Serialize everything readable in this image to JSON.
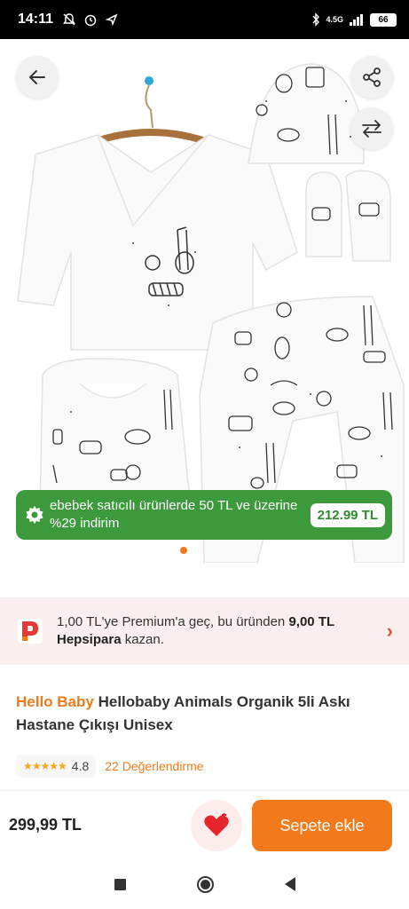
{
  "status_bar": {
    "time": "14:11",
    "network": "4.5G",
    "battery": "66"
  },
  "gallery": {
    "dots": 1,
    "active_dot": 1
  },
  "promo": {
    "text": "ebebek satıcılı ürünlerde 50 TL ve üzerine %29 indirim",
    "price": "212.99 TL"
  },
  "premium": {
    "text_prefix": "1,00 TL'ye Premium'a geç, bu üründen ",
    "amount": "9,00 TL",
    "brand": "Hepsipara",
    "text_suffix": " kazan."
  },
  "product": {
    "brand": "Hello Baby",
    "name": "Hellobaby Animals Organik 5li Askı Hastane Çıkışı Unisex",
    "rating": "4.8",
    "reviews": "22 Değerlendirme"
  },
  "actions": {
    "price": "299,99 TL",
    "add_to_cart": "Sepete ekle"
  },
  "colors": {
    "accent": "#f27a1a",
    "promo_green": "#3c9a3c",
    "premium_bg": "#fbeeee",
    "heart": "#e3262b"
  },
  "icons": [
    "back-arrow-icon",
    "share-icon",
    "compare-icon",
    "gear-badge-icon",
    "hepsipara-logo",
    "chevron-right-icon",
    "heart-icon",
    "star-icon"
  ]
}
